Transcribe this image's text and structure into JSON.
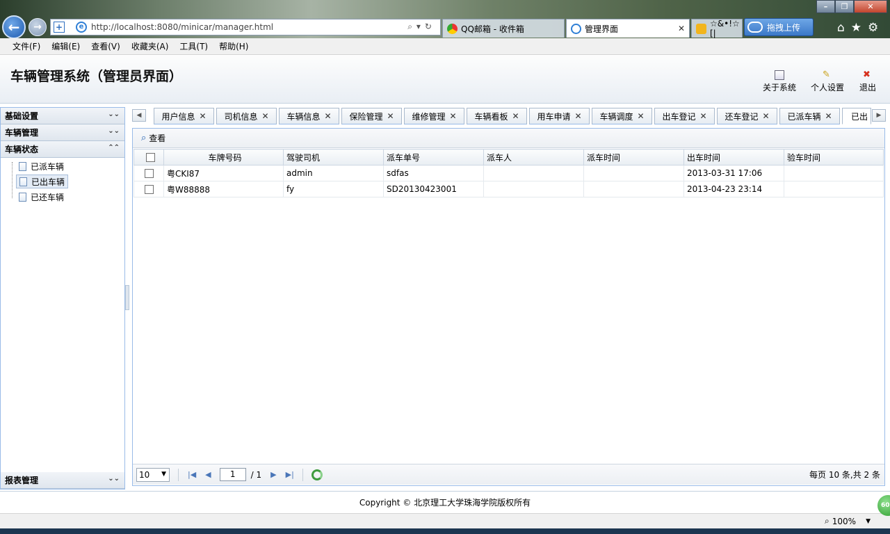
{
  "browser": {
    "url": "http://localhost:8080/minicar/manager.html",
    "tabs": [
      {
        "label": "QQ邮箱 - 收件箱"
      },
      {
        "label": "管理界面"
      },
      {
        "label": "☆&•!☆ [|"
      }
    ],
    "upload_label": "拖拽上传",
    "menu": [
      "文件(F)",
      "编辑(E)",
      "查看(V)",
      "收藏夹(A)",
      "工具(T)",
      "帮助(H)"
    ],
    "zoom": "100%",
    "badge": "60"
  },
  "app": {
    "title": "车辆管理系统（管理员界面）",
    "header_buttons": [
      {
        "label": "关于系统",
        "icon": "info-window-icon"
      },
      {
        "label": "个人设置",
        "icon": "pencil-icon"
      },
      {
        "label": "退出",
        "icon": "close-x-icon"
      }
    ]
  },
  "sidebar": {
    "sections": [
      {
        "label": "基础设置",
        "expanded": false
      },
      {
        "label": "车辆管理",
        "expanded": false
      },
      {
        "label": "车辆状态",
        "expanded": true,
        "items": [
          "已派车辆",
          "已出车辆",
          "已还车辆"
        ],
        "selected": "已出车辆"
      },
      {
        "label": "报表管理",
        "expanded": false
      }
    ]
  },
  "tabs": [
    "用户信息",
    "司机信息",
    "车辆信息",
    "保险管理",
    "维修管理",
    "车辆看板",
    "用车申请",
    "车辆调度",
    "出车登记",
    "还车登记",
    "已派车辆",
    "已出"
  ],
  "toolbar": {
    "view_label": "查看"
  },
  "grid": {
    "columns": [
      "车牌号码",
      "驾驶司机",
      "派车单号",
      "派车人",
      "派车时间",
      "出车时间",
      "验车时间"
    ],
    "rows": [
      [
        "粤CKI87",
        "admin",
        "sdfas",
        "",
        "",
        "2013-03-31 17:06",
        ""
      ],
      [
        "粤W88888",
        "fy",
        "SD20130423001",
        "",
        "",
        "2013-04-23 23:14",
        ""
      ]
    ]
  },
  "pager": {
    "page_size": "10",
    "current_page": "1",
    "total_pages": "/ 1",
    "info": "每页 10 条,共 2 条"
  },
  "footer": {
    "copyright": "Copyright © 北京理工大学珠海学院版权所有"
  }
}
